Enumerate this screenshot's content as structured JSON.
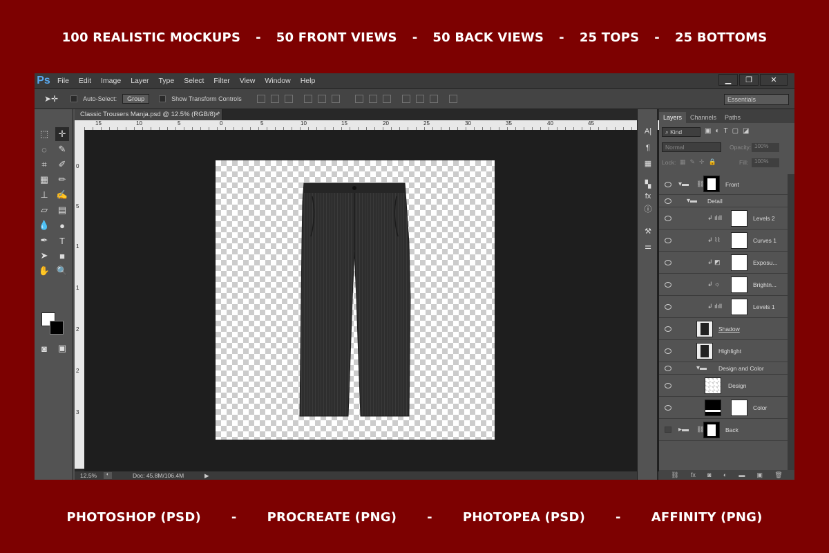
{
  "banner_top": [
    "100 REALISTIC MOCKUPS",
    "-",
    "50 FRONT VIEWS",
    "-",
    "50 BACK VIEWS",
    "-",
    "25 TOPS",
    "-",
    "25 BOTTOMS"
  ],
  "banner_bottom": [
    "PHOTOSHOP (PSD)",
    "-",
    "PROCREATE (PNG)",
    "-",
    "PHOTOPEA (PSD)",
    "-",
    "AFFINITY (PNG)"
  ],
  "app": {
    "logo": "Ps",
    "menu": [
      "File",
      "Edit",
      "Image",
      "Layer",
      "Type",
      "Select",
      "Filter",
      "View",
      "Window",
      "Help"
    ],
    "window_buttons": [
      "▁",
      "❐",
      "✕"
    ]
  },
  "options": {
    "auto_select": "Auto-Select:",
    "group": "Group",
    "show_transform": "Show Transform Controls",
    "workspace": "Essentials"
  },
  "document": {
    "tab": "Classic Trousers Manja.psd @ 12.5% (RGB/8) *",
    "zoom": "12.5%",
    "doc_size": "Doc: 45.8M/106.4M",
    "ruler_h": [
      "15",
      "10",
      "5",
      "0",
      "5",
      "10",
      "15",
      "20",
      "25",
      "30",
      "35",
      "40",
      "45"
    ],
    "ruler_v": [
      "0",
      "5",
      "1",
      "1",
      "2",
      "2",
      "3"
    ]
  },
  "layers_panel": {
    "tabs": [
      "Layers",
      "Channels",
      "Paths"
    ],
    "kind": "Kind",
    "blend": "Normal",
    "opacity_label": "Opacity:",
    "opacity": "100%",
    "lock_label": "Lock:",
    "fill_label": "Fill:",
    "fill": "100%",
    "layers": [
      "Front",
      "Detail",
      "Levels 2",
      "Curves 1",
      "Exposu...",
      "Brightn...",
      "Levels 1",
      "Shadow",
      "Highlight",
      "Design and Color",
      "Design",
      "Color",
      "Back"
    ]
  },
  "colors": {
    "background": "#7d0101",
    "ps_panel": "#535353",
    "ps_accent": "#59a9ef"
  }
}
